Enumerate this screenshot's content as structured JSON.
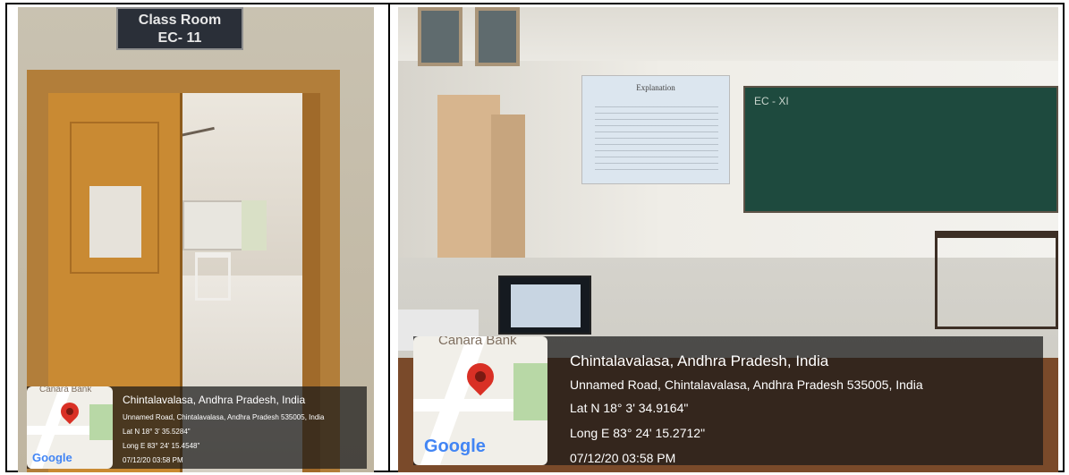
{
  "photos": [
    {
      "sign": {
        "line1": "Class Room",
        "line2": "EC- 11"
      },
      "gps": {
        "location": "Chintalavalasa, Andhra Pradesh, India",
        "address": "Unnamed Road, Chintalavalasa, Andhra Pradesh 535005, India",
        "lat": "Lat N 18° 3' 35.5284\"",
        "long": "Long E 83° 24' 15.4548\"",
        "datetime": "07/12/20 03:58 PM",
        "map_label": "Canara Bank",
        "brand": "Google"
      }
    },
    {
      "projection_title": "Explanation",
      "board_text": "EC - XI",
      "gps": {
        "location": "Chintalavalasa, Andhra Pradesh, India",
        "address": "Unnamed Road, Chintalavalasa, Andhra Pradesh 535005, India",
        "lat": "Lat N 18° 3' 34.9164\"",
        "long": "Long E 83° 24' 15.2712\"",
        "datetime": "07/12/20 03:58 PM",
        "map_label": "Canara Bank",
        "brand": "Google"
      }
    }
  ],
  "colors": {
    "map_pin": "#d93025",
    "google_blue": "#4285f4",
    "board": "#1e4a3e",
    "door": "#c98a33"
  }
}
